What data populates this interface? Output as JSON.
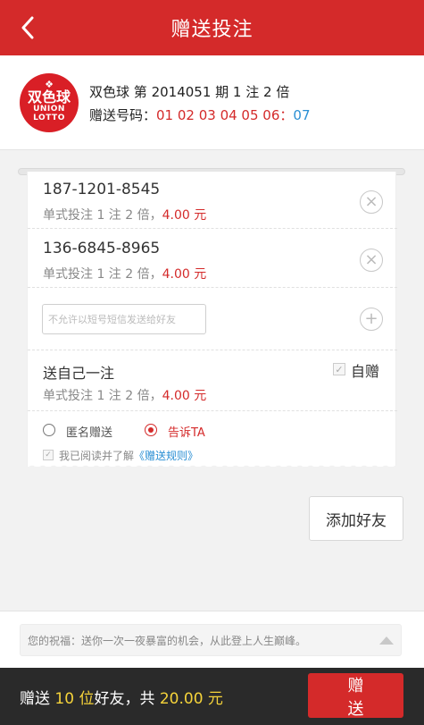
{
  "header": {
    "title": "赠送投注",
    "back_icon": "chevron-left-icon"
  },
  "lottery": {
    "logo": {
      "line1": "双色球",
      "line2": "UNION",
      "line3": "LOTTO",
      "color": "#d91f26"
    },
    "name": "双色球",
    "issue_text": "第 2014051 期",
    "bet_text": "1 注 2 倍",
    "numbers_label": "赠送号码：",
    "red_numbers": "01 02 03 04 05 06",
    "separator": "：",
    "blue_number": "07"
  },
  "recipients": [
    {
      "phone": "187-1201-8545",
      "desc": "单式投注 1 注 2 倍，",
      "amount": "4.00 元",
      "remove_icon": "circle-x-icon"
    },
    {
      "phone": "136-6845-8965",
      "desc": "单式投注 1 注 2 倍，",
      "amount": "4.00 元",
      "remove_icon": "circle-x-icon"
    }
  ],
  "new_recipient": {
    "placeholder": "不允许以短号短信发送给好友",
    "add_icon": "circle-plus-icon"
  },
  "self_gift": {
    "title": "送自己一注",
    "desc": "单式投注 1 注 2 倍，",
    "amount": "4.00 元",
    "checkbox_label": "自赠",
    "checked": true
  },
  "options": {
    "anonymous": "匿名赠送",
    "tell": "告诉TA",
    "selected": "tell"
  },
  "agreement": {
    "text": "我已阅读并了解",
    "link": "《赠送规则》",
    "checked": true
  },
  "add_friend_label": "添加好友",
  "wish": {
    "text": "您的祝福：送你一次一夜暴富的机会，从此登上人生巅峰。",
    "expand_icon": "triangle-up-icon"
  },
  "footer": {
    "prefix": "赠送 ",
    "count": "10 位",
    "middle": "好友，共 ",
    "total": "20.00 元",
    "send_label": "赠送"
  },
  "colors": {
    "primary_red": "#d42a2a",
    "blue_ball": "#2a8fd4",
    "highlight_yellow": "#f5d33a",
    "footer_bg": "#2a2a2a"
  }
}
